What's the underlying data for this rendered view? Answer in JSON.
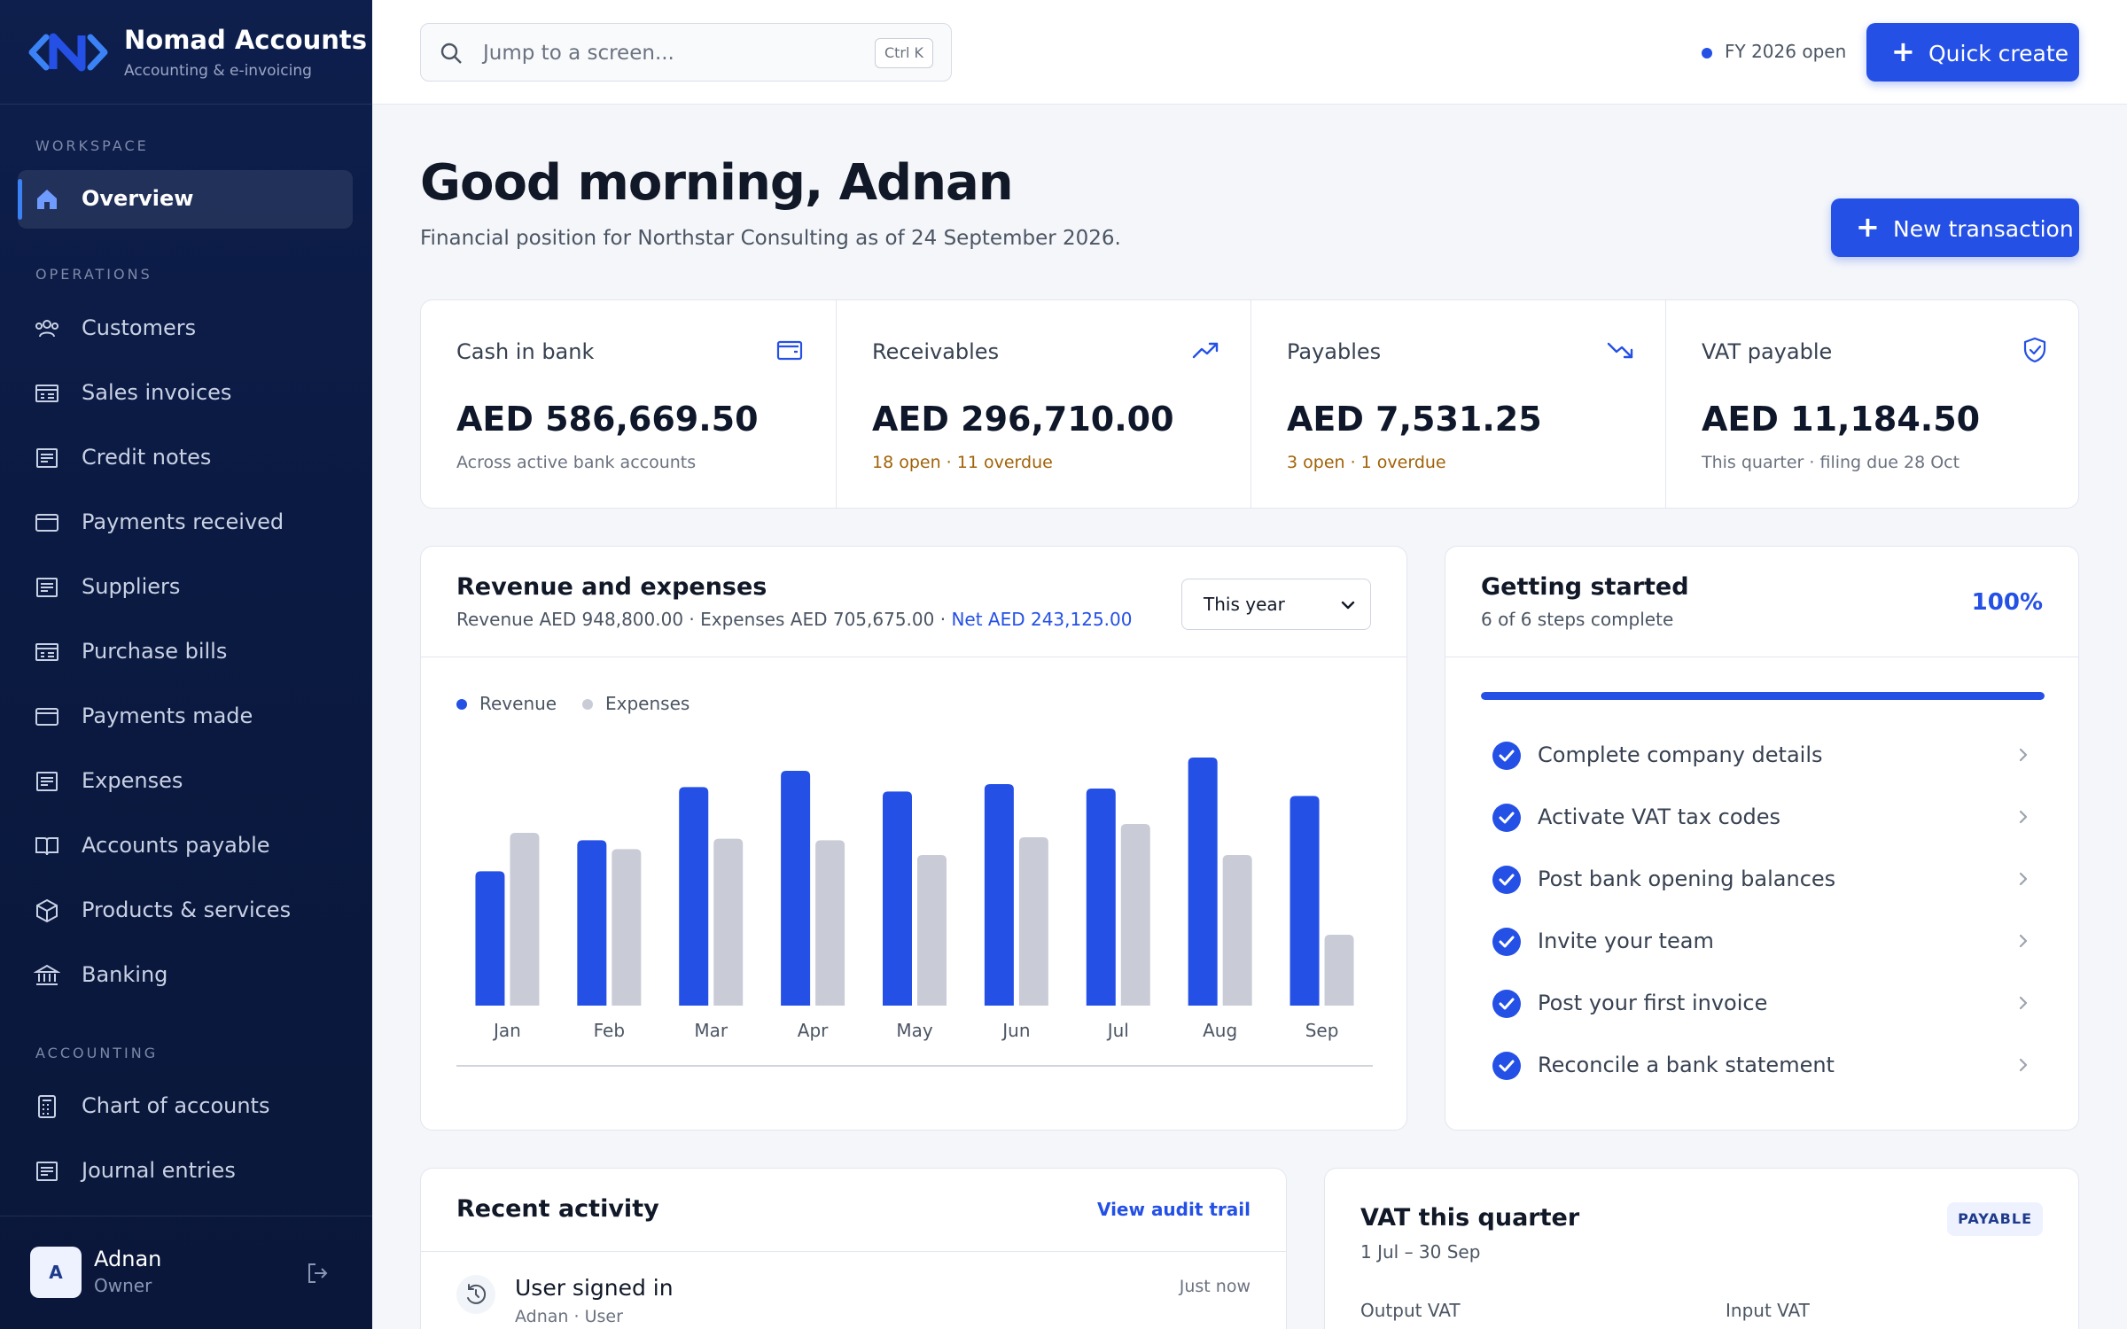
{
  "brand": {
    "name": "Nomad Accounts",
    "subtitle": "Accounting & e-invoicing"
  },
  "sidebar": {
    "sections": {
      "workspace": "WORKSPACE",
      "operations": "OPERATIONS",
      "accounting": "ACCOUNTING"
    },
    "workspace_items": [
      {
        "label": "Overview",
        "icon": "home-icon",
        "active": true
      }
    ],
    "operations_items": [
      {
        "label": "Customers",
        "icon": "users-icon"
      },
      {
        "label": "Sales invoices",
        "icon": "invoice-icon"
      },
      {
        "label": "Credit notes",
        "icon": "document-icon"
      },
      {
        "label": "Payments received",
        "icon": "wallet-icon"
      },
      {
        "label": "Suppliers",
        "icon": "document-icon"
      },
      {
        "label": "Purchase bills",
        "icon": "invoice-icon"
      },
      {
        "label": "Payments made",
        "icon": "wallet-icon"
      },
      {
        "label": "Expenses",
        "icon": "document-icon"
      },
      {
        "label": "Accounts payable",
        "icon": "book-icon"
      },
      {
        "label": "Products & services",
        "icon": "box-icon"
      },
      {
        "label": "Banking",
        "icon": "bank-icon"
      }
    ],
    "accounting_items": [
      {
        "label": "Chart of accounts",
        "icon": "calculator-icon"
      },
      {
        "label": "Journal entries",
        "icon": "document-icon"
      }
    ],
    "user": {
      "initial": "A",
      "name": "Adnan",
      "role": "Owner"
    }
  },
  "topbar": {
    "search_placeholder": "Jump to a screen...",
    "search_shortcut": "Ctrl K",
    "fiscal_status": "FY 2026 open",
    "quick_create_label": "Quick create"
  },
  "header": {
    "greeting": "Good morning, Adnan",
    "subtitle": "Financial position for Northstar Consulting as of 24 September 2026.",
    "new_transaction_label": "New transaction"
  },
  "kpis": [
    {
      "label": "Cash in bank",
      "value": "AED 586,669.50",
      "note": "Across active bank accounts",
      "icon": "wallet-icon",
      "warn": false
    },
    {
      "label": "Receivables",
      "value": "AED 296,710.00",
      "note": "18 open · 11 overdue",
      "icon": "trend-up-icon",
      "warn": true
    },
    {
      "label": "Payables",
      "value": "AED 7,531.25",
      "note": "3 open · 1 overdue",
      "icon": "trend-down-icon",
      "warn": true
    },
    {
      "label": "VAT payable",
      "value": "AED 11,184.50",
      "note": "This quarter · filing due 28 Oct",
      "icon": "shield-check-icon",
      "warn": false
    }
  ],
  "revenue_card": {
    "title": "Revenue and expenses",
    "summary": "Revenue AED 948,800.00 · Expenses AED 705,675.00 · ",
    "net": "Net AED 243,125.00",
    "period": "This year"
  },
  "chart_data": {
    "type": "bar",
    "categories": [
      "Jan",
      "Feb",
      "Mar",
      "Apr",
      "May",
      "Jun",
      "Jul",
      "Aug",
      "Sep"
    ],
    "series": [
      {
        "name": "Revenue",
        "values": [
          91000,
          112000,
          148000,
          159000,
          145000,
          150000,
          147000,
          168000,
          142000
        ]
      },
      {
        "name": "Expenses",
        "values": [
          117000,
          106000,
          113000,
          112000,
          102000,
          114000,
          123000,
          102000,
          48000
        ]
      }
    ],
    "ylim": [
      0,
      180000
    ],
    "grid": false,
    "legend": "top-left",
    "colors": {
      "Revenue": "#2450e6",
      "Expenses": "#c9ccd6"
    }
  },
  "getting_started": {
    "title": "Getting started",
    "subtitle": "6 of 6 steps complete",
    "percent_label": "100%",
    "progress": 1.0,
    "steps": [
      "Complete company details",
      "Activate VAT tax codes",
      "Post bank opening balances",
      "Invite your team",
      "Post your first invoice",
      "Reconcile a bank statement"
    ]
  },
  "recent_activity": {
    "title": "Recent activity",
    "link": "View audit trail",
    "items": [
      {
        "title": "User signed in",
        "sub": "Adnan · User",
        "time": "Just now",
        "icon": "history-icon"
      }
    ]
  },
  "vat_card": {
    "title": "VAT this quarter",
    "period": "1 Jul – 30 Sep",
    "badge": "PAYABLE",
    "output_label": "Output VAT",
    "input_label": "Input VAT"
  },
  "colors": {
    "accent": "#2450e6",
    "sidebar": "#0e1f4d",
    "warn": "#a16207"
  }
}
